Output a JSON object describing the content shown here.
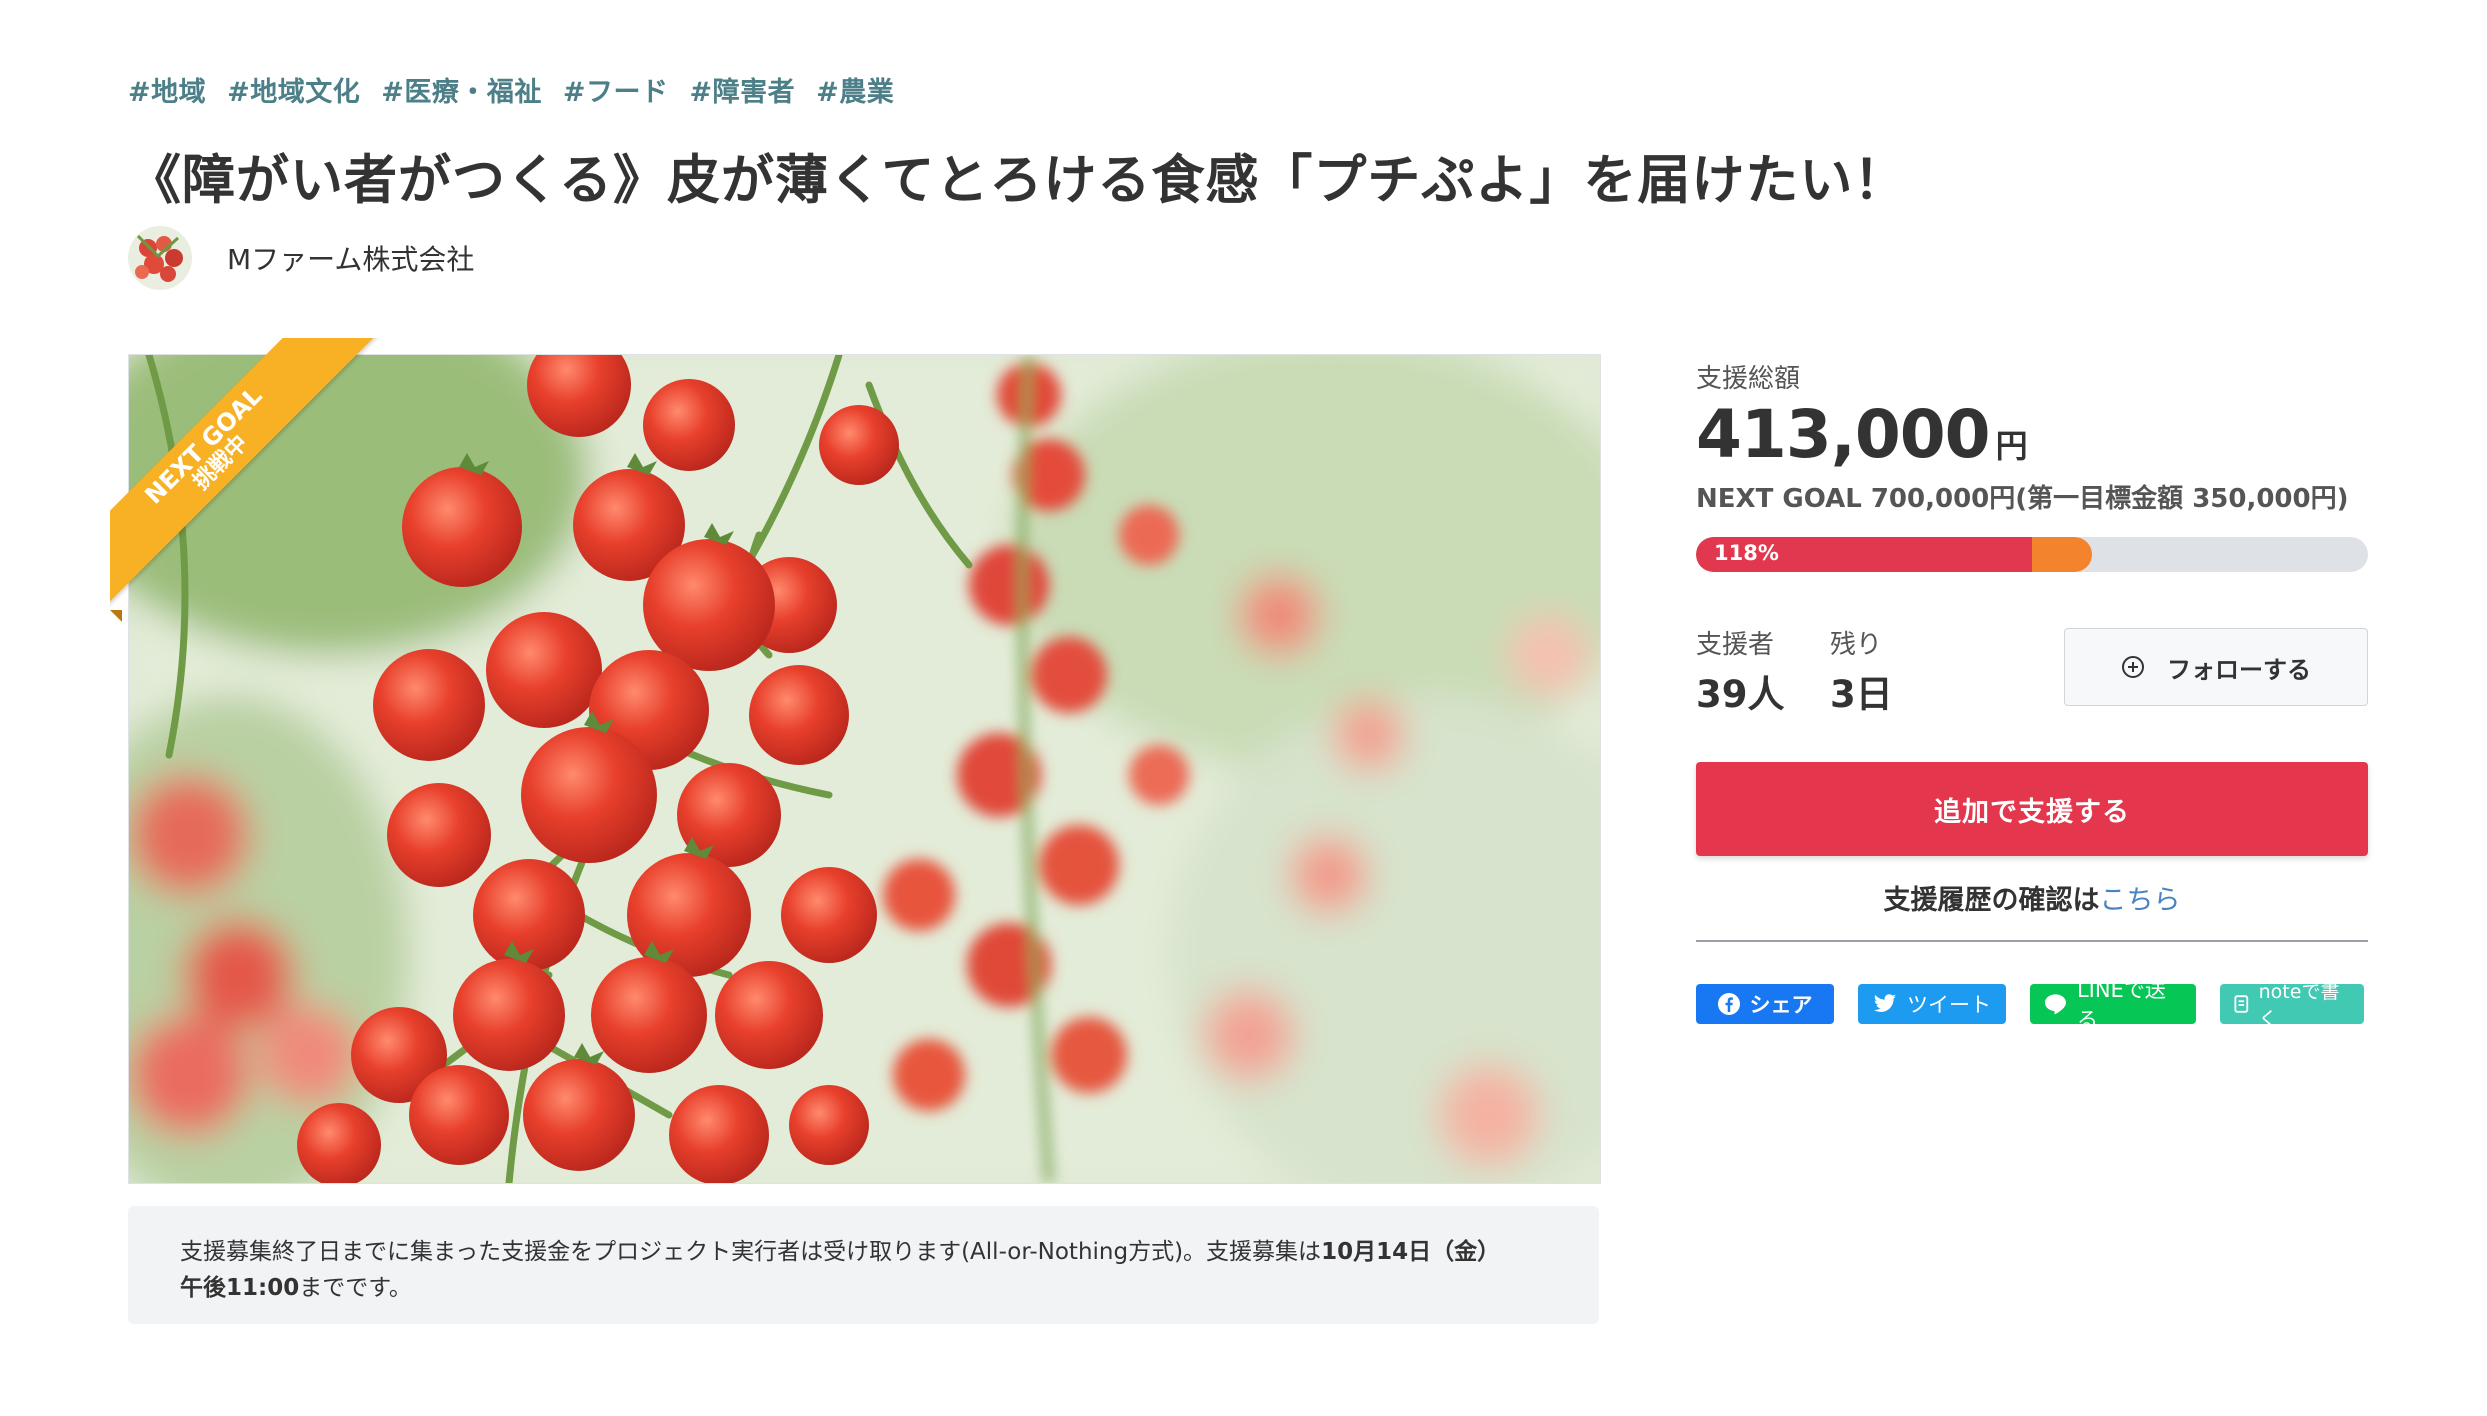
{
  "tags": [
    "#地域",
    "#地域文化",
    "#医療・福祉",
    "#フード",
    "#障害者",
    "#農業"
  ],
  "title": "《障がい者がつくる》皮が薄くてとろける食感「プチぷよ」を届けたい！",
  "owner": {
    "name": "Mファーム株式会社"
  },
  "ribbon": {
    "line1": "NEXT GOAL",
    "line2": "挑戦中"
  },
  "notice": {
    "text1": "支援募集終了日までに集まった支援金をプロジェクト実行者は受け取ります(All-or-Nothing方式)。支援募集は",
    "bold1": "10月14日（金）",
    "bold2": "午後11:00",
    "text2": "までです。"
  },
  "stats": {
    "total_label": "支援総額",
    "total_amount": "413,000",
    "total_unit": "円",
    "goal_text": "NEXT GOAL 700,000円(第一目標金額 350,000円)",
    "progress_label": "118%",
    "progress_primary_fraction": 0.5,
    "progress_secondary_fraction": 0.59,
    "supporters_label": "支援者",
    "supporters_value": "39人",
    "remaining_label": "残り",
    "remaining_value": "3日"
  },
  "follow_label": "フォローする",
  "support_button": "追加で支援する",
  "history": {
    "text": "支援履歴の確認は",
    "link": "こちら"
  },
  "share": {
    "facebook": "シェア",
    "twitter": "ツイート",
    "line": "LINEで送る",
    "note": "noteで書く"
  },
  "colors": {
    "accent": "#e4364d",
    "progress_red": "#e2384f",
    "progress_orange": "#f4832e",
    "ribbon": "#f8b024",
    "tag": "#4c7f88",
    "link": "#4a82c3"
  }
}
